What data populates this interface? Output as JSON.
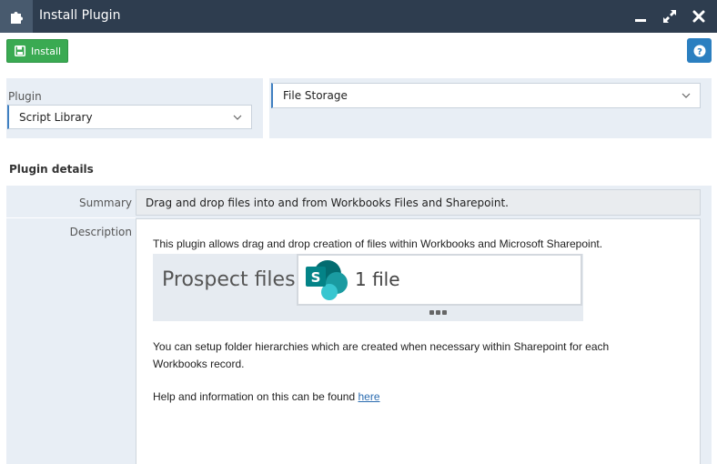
{
  "window": {
    "title": "Install Plugin"
  },
  "toolbar": {
    "install_label": "Install"
  },
  "form": {
    "plugin_label": "Plugin",
    "plugin_type_value": "Script Library",
    "plugin_value": "File Storage"
  },
  "details": {
    "section_title": "Plugin details",
    "summary_label": "Summary",
    "summary_value": "Drag and drop files into and from Workbooks Files and Sharepoint.",
    "description_label": "Description",
    "description_line1": "This plugin allows drag and drop creation of files within Workbooks and Microsoft Sharepoint.",
    "preview_prospect": "Prospect files",
    "preview_count": "1 file",
    "description_line2": "You can setup folder hierarchies which are created when necessary within Sharepoint for each Workbooks record.",
    "description_line3": "Help and information on this can be found ",
    "help_link": "here"
  },
  "icons": {
    "app": "puzzle-icon",
    "minimize": "minimize-icon",
    "maximize": "maximize-icon",
    "close": "close-icon",
    "install": "save-icon",
    "help": "help-icon",
    "sharepoint": "sharepoint-icon"
  },
  "colors": {
    "titlebar": "#2e3d4f",
    "install_button": "#3aaa52",
    "help_button": "#2b7fc0",
    "panel": "#e8eef5",
    "sharepoint": "#038387"
  }
}
